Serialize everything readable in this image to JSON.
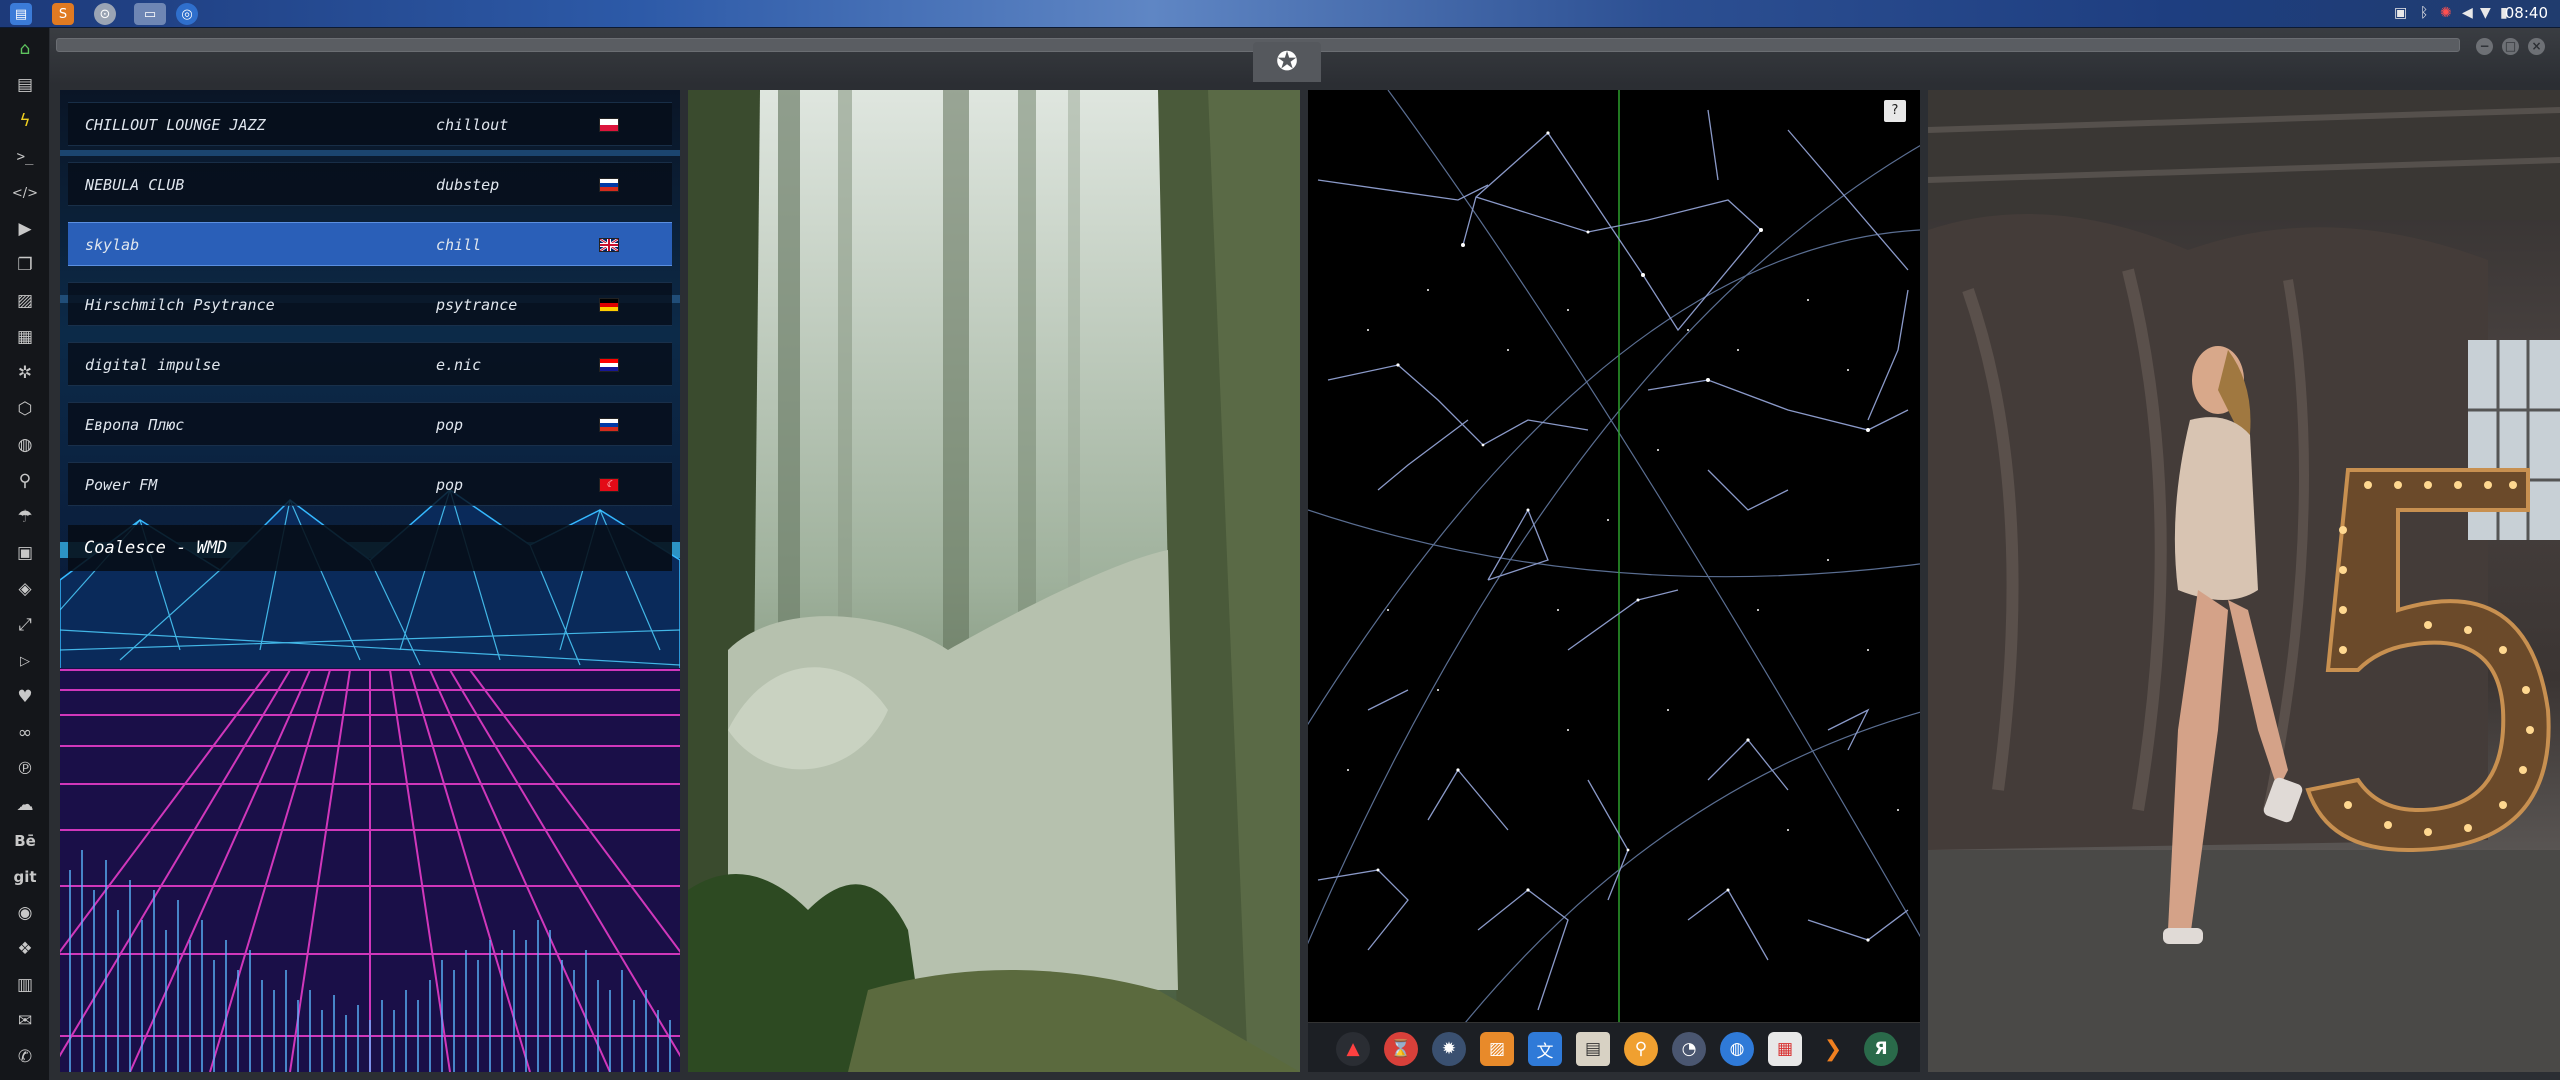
{
  "topbar": {
    "clock": "08:40",
    "launchers": [
      "files-icon",
      "sublime-icon",
      "app-si-icon",
      "window-icon",
      "chromium-icon"
    ],
    "tray": [
      "image-icon",
      "bluetooth-icon",
      "bug-icon",
      "volume-icon",
      "wifi-icon",
      "battery-icon"
    ]
  },
  "leftdock": {
    "icons": [
      "home-icon",
      "document-icon",
      "lightning-icon",
      "terminal-icon",
      "code-icon",
      "play-icon",
      "file-icon",
      "image-icon",
      "newspaper-icon",
      "settings-icon",
      "hexagon-icon",
      "globe-icon",
      "search-icon",
      "umbrella-icon",
      "contact-icon",
      "diamond-icon",
      "expand-icon",
      "youtube-icon",
      "heart-icon",
      "lastfm-icon",
      "pinterest-icon",
      "cloud-icon",
      "behance-icon",
      "git-icon",
      "github-icon",
      "cubes-icon",
      "map-icon",
      "envelope-icon",
      "mail-icon"
    ],
    "behance_label": "Bē",
    "git_label": "git"
  },
  "radio": {
    "stations": [
      {
        "name": "CHILLOUT LOUNGE JAZZ",
        "genre": "chillout",
        "flag": "pl"
      },
      {
        "name": "NEBULA CLUB",
        "genre": "dubstep",
        "flag": "ru"
      },
      {
        "name": "skylab",
        "genre": "chill",
        "flag": "gb"
      },
      {
        "name": "Hirschmilch Psytrance",
        "genre": "psytrance",
        "flag": "de"
      },
      {
        "name": "digital impulse",
        "genre": "e.nic",
        "flag": "hr"
      },
      {
        "name": "Европа Плюс",
        "genre": "pop",
        "flag": "ru"
      },
      {
        "name": "Power FM",
        "genre": "pop",
        "flag": "tr"
      }
    ],
    "active_index": 2,
    "now_playing": "Coalesce - WMD"
  },
  "stars": {
    "help_label": "?"
  },
  "bottomdock": {
    "icons": [
      "arch-icon",
      "hourglass-icon",
      "planet-icon",
      "image-viewer-icon",
      "translate-icon",
      "notes-icon",
      "search-icon",
      "clock-icon",
      "globe-icon",
      "calendar-icon",
      "terminal-arrow-icon",
      "yandex-icon"
    ],
    "yandex_label": "Я"
  },
  "colors": {
    "accent": "#2a5fb8",
    "grid_pink": "#e43cc8",
    "grid_blue": "#2cb0f0"
  }
}
